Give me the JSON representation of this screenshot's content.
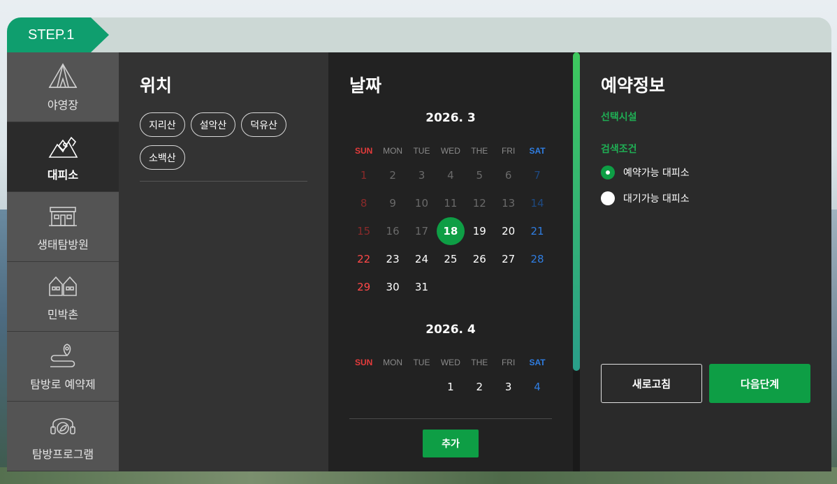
{
  "step": {
    "label": "STEP.1"
  },
  "sidebar": {
    "items": [
      {
        "label": "야영장",
        "icon": "tent-icon",
        "active": false
      },
      {
        "label": "대피소",
        "icon": "shelter-mountain-icon",
        "active": true
      },
      {
        "label": "생태탐방원",
        "icon": "lodge-building-icon",
        "active": false
      },
      {
        "label": "민박촌",
        "icon": "houses-icon",
        "active": false
      },
      {
        "label": "탐방로 예약제",
        "icon": "trail-pin-icon",
        "active": false
      },
      {
        "label": "탐방프로그램",
        "icon": "headset-leaf-icon",
        "active": false
      }
    ]
  },
  "location": {
    "title": "위치",
    "chips": [
      "지리산",
      "설악산",
      "덕유산",
      "소백산"
    ]
  },
  "date": {
    "title": "날짜",
    "weekdays": [
      "SUN",
      "MON",
      "TUE",
      "WED",
      "THE",
      "FRI",
      "SAT"
    ],
    "months": [
      {
        "title": "2026. 3",
        "weeks": [
          [
            "1",
            "2",
            "3",
            "4",
            "5",
            "6",
            "7"
          ],
          [
            "8",
            "9",
            "10",
            "11",
            "12",
            "13",
            "14"
          ],
          [
            "15",
            "16",
            "17",
            "18",
            "19",
            "20",
            "21"
          ],
          [
            "22",
            "23",
            "24",
            "25",
            "26",
            "27",
            "28"
          ],
          [
            "29",
            "30",
            "31",
            "",
            "",
            "",
            ""
          ]
        ],
        "past_until": 17,
        "selected": "18"
      },
      {
        "title": "2026. 4",
        "weeks": [
          [
            "",
            "",
            "",
            "1",
            "2",
            "3",
            "4"
          ]
        ],
        "past_until": 0,
        "selected": ""
      }
    ],
    "add_label": "추가",
    "scroll_fraction": 0.76
  },
  "info": {
    "title": "예약정보",
    "facility_label": "선택시설",
    "condition_label": "검색조건",
    "options": [
      {
        "label": "예약가능 대피소",
        "selected": true
      },
      {
        "label": "대기가능 대피소",
        "selected": false
      }
    ],
    "refresh_label": "새로고침",
    "next_label": "다음단계"
  },
  "colors": {
    "accent": "#0e9e45",
    "step_tag": "#0f9e6e",
    "sunday": "#ff4848",
    "saturday": "#2f7de1"
  }
}
